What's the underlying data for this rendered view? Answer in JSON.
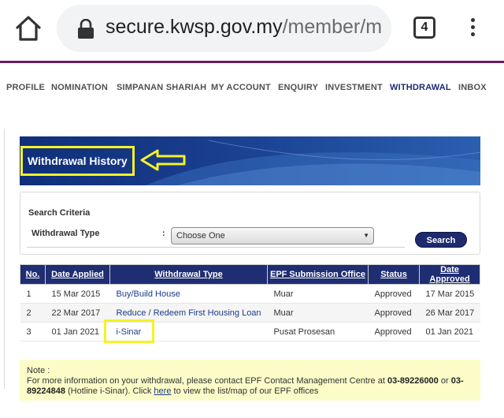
{
  "browser": {
    "url_host": "secure.kwsp.gov.my",
    "url_path": "/member/m",
    "tab_count": "4",
    "accent_color": "#6a1e5f"
  },
  "nav": {
    "items": [
      {
        "label": "PROFILE"
      },
      {
        "label": "NOMINATION"
      },
      {
        "label": "SIMPANAN SHARIAH"
      },
      {
        "label": "MY ACCOUNT"
      },
      {
        "label": "ENQUIRY"
      },
      {
        "label": "INVESTMENT"
      },
      {
        "label": "WITHDRAWAL",
        "active": true
      },
      {
        "label": "INBOX"
      }
    ],
    "active_color": "#1e2b73"
  },
  "banner": {
    "title": "Withdrawal History",
    "highlight_color": "#f5f229"
  },
  "criteria": {
    "title": "Search Criteria",
    "field_label": "Withdrawal Type",
    "colon": ":",
    "select_value": "Choose One",
    "search_label": "Search"
  },
  "table": {
    "headers": [
      "No.",
      "Date Applied",
      "Withdrawal Type",
      "EPF Submission Office",
      "Status",
      "Date Approved"
    ],
    "rows": [
      {
        "no": "1",
        "date_applied": "15 Mar 2015",
        "type": "Buy/Build House",
        "office": "Muar",
        "status": "Approved",
        "date_approved": "17 Mar 2015"
      },
      {
        "no": "2",
        "date_applied": "22 Mar 2017",
        "type": "Reduce / Redeem First Housing Loan",
        "office": "Muar",
        "status": "Approved",
        "date_approved": "26 Mar 2017"
      },
      {
        "no": "3",
        "date_applied": "01 Jan 2021",
        "type": "i-Sinar",
        "office": "Pusat Prosesan",
        "status": "Approved",
        "date_approved": "01 Jan 2021"
      }
    ],
    "header_color": "#1f2d72"
  },
  "note": {
    "label": "Note :",
    "text_before": "For more information on your withdrawal, please contact EPF Contact Management Centre at ",
    "phone1": "03-89226000",
    "or": " or ",
    "phone2": "03-89224848",
    "hotline": " (Hotline i-Sinar). Click ",
    "link": "here",
    "text_after": " to view the list/map of our EPF offices",
    "bg_color": "#fcfcc8"
  }
}
